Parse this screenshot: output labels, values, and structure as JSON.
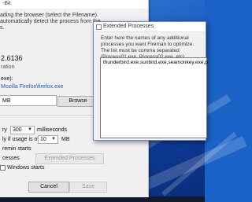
{
  "main": {
    "title": "-Bit",
    "instruction_line1": "ading the browser (select the Filename).",
    "instruction_line2": "automatically detect the process from the",
    "instruction_line3": "s.",
    "version": "2.6136",
    "version_label": "ration",
    "exe_label": "exe):",
    "browser_path": "Mozilla Firefox\\firefox.exe",
    "size_label": "MB",
    "browse_label": "Browse",
    "every_label": "ry",
    "every_value": "300",
    "milliseconds_label": "milliseconds",
    "usage_label": "ly if usage is over",
    "usage_value": "10",
    "usage_unit": "MB",
    "starts_label": "remin starts",
    "processes_label": "cesses",
    "extended_processes_label": "Extended Processes",
    "windows_starts_label": "Windows starts",
    "cancel_label": "Cancel",
    "save_label": "Save"
  },
  "dialog": {
    "title": "Extended Processes",
    "description": "Enter here the names of any additional processes you want Fireman to optimize. The list must be comma separated (Process01.exe, Process02.exe, etc)",
    "processes_value": "thunderbird.exe,sunbird.exe,seamonkey.exe,p"
  }
}
